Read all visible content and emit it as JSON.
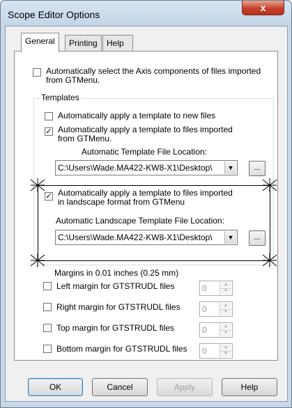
{
  "window": {
    "title": "Scope Editor Options",
    "close_label": "x"
  },
  "tabs": [
    {
      "label": "General",
      "active": true
    },
    {
      "label": "Printing",
      "active": false
    },
    {
      "label": "Help",
      "active": false
    }
  ],
  "general": {
    "auto_select_axis": {
      "line1": "Automatically select the Axis components of files imported",
      "line2": "from GTMenu.",
      "checked": false
    },
    "templates": {
      "legend": "Templates",
      "apply_new": {
        "label": "Automatically apply a template to new files",
        "checked": false
      },
      "apply_imported": {
        "line1": "Automatically apply a template to files imported",
        "line2": "from GTMenu.",
        "checked": true
      },
      "template_location_label": "Automatic Template File Location:",
      "template_location_value": "C:\\Users\\Wade.MA422-KW8-X1\\Desktop\\",
      "apply_landscape": {
        "line1": "Automatically apply a template to files imported",
        "line2": "in landscape format from GTMenu",
        "checked": true
      },
      "landscape_location_label": "Automatic Landscape Template File Location:",
      "landscape_location_value": "C:\\Users\\Wade.MA422-KW8-X1\\Desktop\\",
      "browse_label": "..."
    },
    "margins": {
      "heading": "Margins in 0.01 inches (0.25 mm)",
      "items": [
        {
          "label": "Left margin for GTSTRUDL files",
          "value": "0",
          "checked": false
        },
        {
          "label": "Right margin for GTSTRUDL files",
          "value": "0",
          "checked": false
        },
        {
          "label": "Top margin for GTSTRUDL files",
          "value": "0",
          "checked": false
        },
        {
          "label": "Bottom margin for GTSTRUDL files",
          "value": "0",
          "checked": false
        }
      ]
    }
  },
  "buttons": {
    "ok": "OK",
    "cancel": "Cancel",
    "apply": "Apply",
    "help": "Help"
  },
  "glyphs": {
    "check": "✓",
    "dropdown": "▼",
    "up": "▲",
    "down": "▼"
  }
}
